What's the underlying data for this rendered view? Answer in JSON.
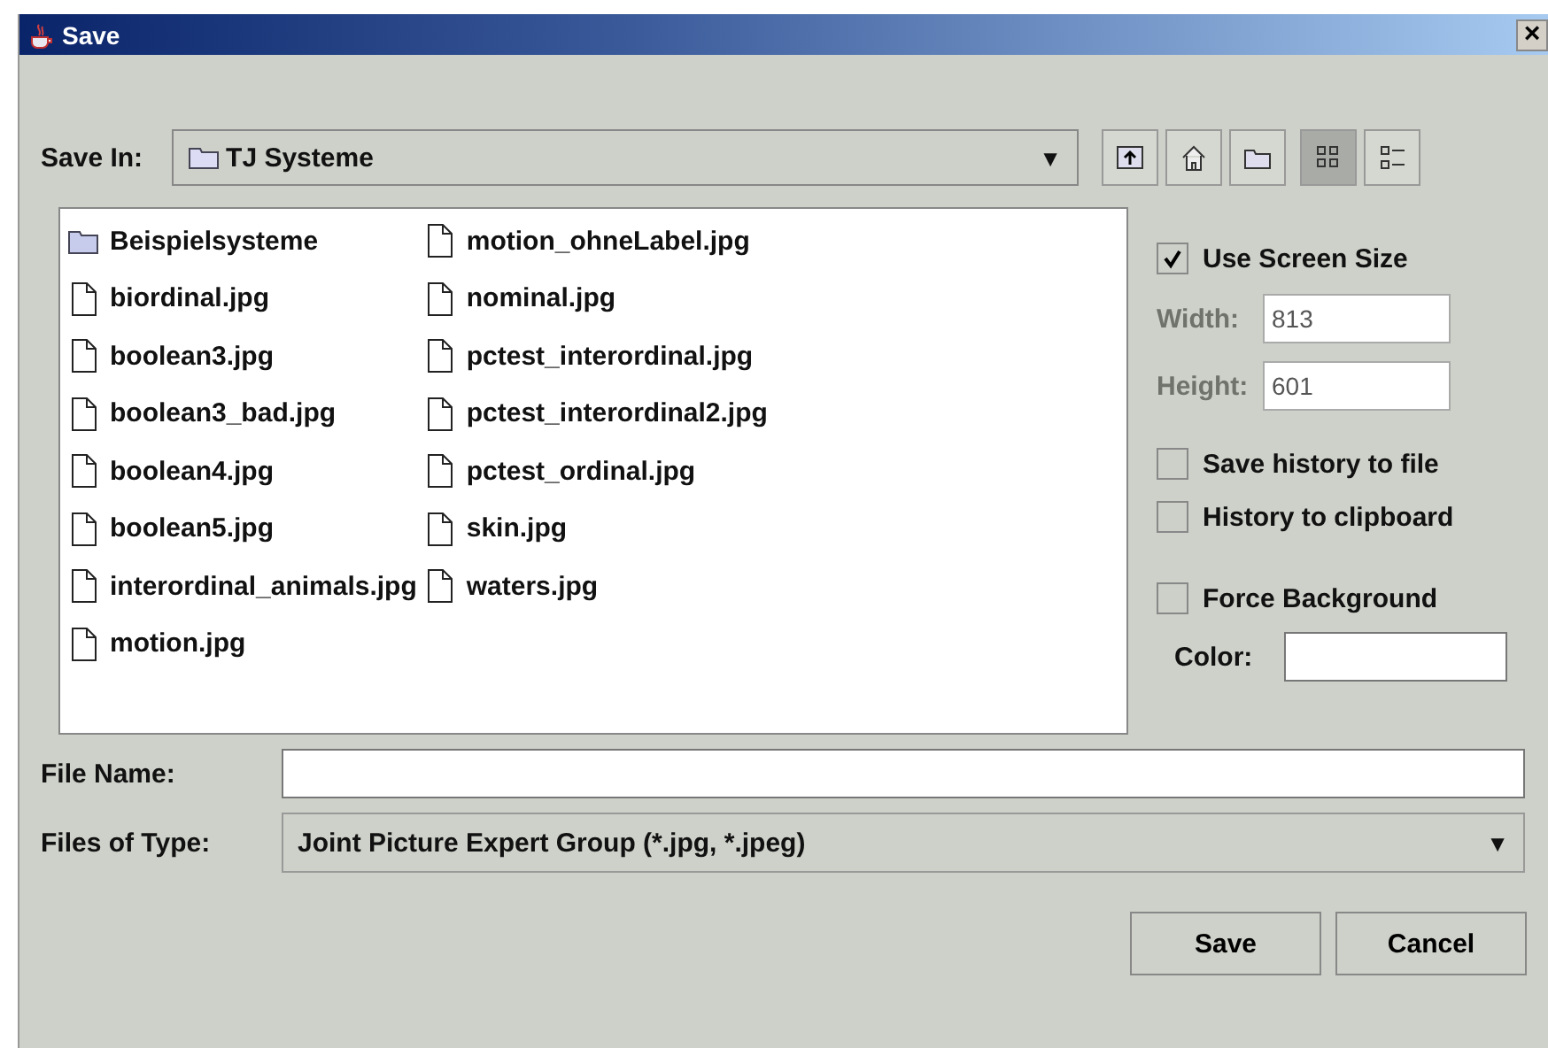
{
  "window": {
    "title": "Save",
    "close": "×"
  },
  "save_in": {
    "label": "Save In:",
    "value": "TJ Systeme",
    "arrow": "▼"
  },
  "toolbar": [
    {
      "kind": "up",
      "selected": false
    },
    {
      "kind": "home",
      "selected": false
    },
    {
      "kind": "new-folder",
      "selected": false
    },
    {
      "kind": "list",
      "selected": true
    },
    {
      "kind": "details",
      "selected": false
    }
  ],
  "files": [
    {
      "name": "Beispielsysteme",
      "kind": "folder"
    },
    {
      "name": "biordinal.jpg",
      "kind": "file"
    },
    {
      "name": "boolean3.jpg",
      "kind": "file"
    },
    {
      "name": "boolean3_bad.jpg",
      "kind": "file"
    },
    {
      "name": "boolean4.jpg",
      "kind": "file"
    },
    {
      "name": "boolean5.jpg",
      "kind": "file"
    },
    {
      "name": "interordinal_animals.jpg",
      "kind": "file"
    },
    {
      "name": "motion.jpg",
      "kind": "file"
    },
    {
      "name": "motion_ohneLabel.jpg",
      "kind": "file"
    },
    {
      "name": "nominal.jpg",
      "kind": "file"
    },
    {
      "name": "pctest_interordinal.jpg",
      "kind": "file"
    },
    {
      "name": "pctest_interordinal2.jpg",
      "kind": "file"
    },
    {
      "name": "pctest_ordinal.jpg",
      "kind": "file"
    },
    {
      "name": "skin.jpg",
      "kind": "file"
    },
    {
      "name": "waters.jpg",
      "kind": "file"
    }
  ],
  "options": {
    "use_screen_size": {
      "label": "Use Screen Size",
      "checked": true
    },
    "width": {
      "label": "Width:",
      "value": "813",
      "disabled": true
    },
    "height": {
      "label": "Height:",
      "value": "601",
      "disabled": true
    },
    "save_history": {
      "label": "Save history to file",
      "checked": false
    },
    "history_clipboard": {
      "label": "History to clipboard",
      "checked": false
    },
    "force_background": {
      "label": "Force Background",
      "checked": false
    },
    "color": {
      "label": "Color:"
    }
  },
  "file_name": {
    "label": "File Name:"
  },
  "file_type": {
    "label": "Files of Type:",
    "value": "Joint Picture Expert Group (*.jpg, *.jpeg)",
    "arrow": "▼"
  },
  "buttons": [
    "Save",
    "Cancel"
  ]
}
